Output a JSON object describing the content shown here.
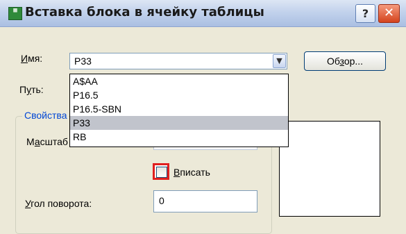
{
  "window": {
    "title": "Вставка блока в ячейку таблицы",
    "help_label": "?",
    "close_label": "✕",
    "icon_text": "▦"
  },
  "form": {
    "name_label": "Имя:",
    "name_value": "Р33",
    "browse_label": "Обзор...",
    "path_label": "Путь:",
    "group_label": "Свойства",
    "scale_label": "Масштаб",
    "fit_label": "Вписать",
    "fit_checked": false,
    "angle_label": "Угол поворота:",
    "angle_value": "0"
  },
  "dropdown": {
    "items": [
      "A$AA",
      "P16.5",
      "P16.5-SBN",
      "P33",
      "RB"
    ],
    "selected": "P33"
  },
  "colors": {
    "highlight_border": "#e01f1f",
    "group_title": "#0046d5",
    "selected_item": "#c1c4cc"
  }
}
